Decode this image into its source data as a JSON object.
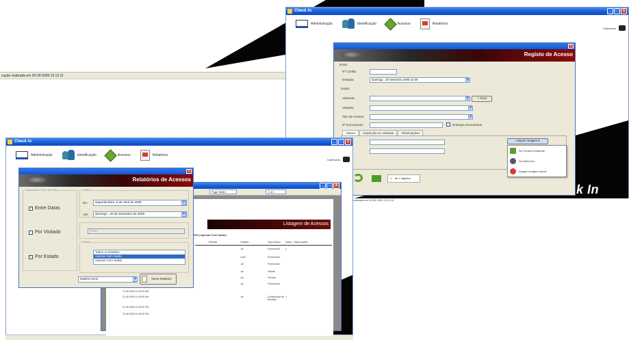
{
  "background_status": {
    "text": "cação realizada em 20-09-2009 22:12:11"
  },
  "top_window": {
    "title": "Check In",
    "nav": {
      "admin": "Administração",
      "ident": "Identificação",
      "acess": "Acessos",
      "rel": "Relatórios"
    },
    "user_label": "Caleridens",
    "status_text": "realizada em 20-09-2009 22:12:11",
    "logo_text": "Check In"
  },
  "registo_dialog": {
    "title": "Registo de Acesso",
    "section_entrada": "Entra",
    "labels": {
      "cartao": "Nº Cartão:",
      "entrada": "Entrada:",
      "saida": "Saída:",
      "visitante": "Visitante:",
      "visitado": "Visitado:",
      "tipo": "Tipo de Acesso:",
      "documento": "Nº Documento:",
      "matricula": "atricula:",
      "viatura": "ra:"
    },
    "values": {
      "cartao": "",
      "entrada": "domingo   , 20 Setembro 2009 22:09",
      "visitante": "",
      "visitado": "",
      "tipo": "",
      "documento": "",
      "matricula": "",
      "viatura": ""
    },
    "novo_button": "Novo",
    "entregou_doc": "Entregou Documento",
    "tabs": [
      "Viatura",
      "Inspecção ao Visitante",
      "Observações"
    ],
    "acquire_button": "Adquirir Imagem",
    "image_menu": [
      "Do Ficheiro Existente",
      "Da WebCam",
      "Apagar Imagem Actual"
    ],
    "record_counter": "1",
    "record_total": "de 1 registos"
  },
  "bottom_window": {
    "title": "Check In",
    "nav": {
      "admin": "Administração",
      "ident": "Identificação",
      "acess": "Acessos",
      "rel": "Relatórios"
    },
    "user_label": "Caleridens"
  },
  "report_window": {
    "page_label": "Page Width",
    "page_nav": "1 of 1",
    "header": "Listagem de Acessos",
    "filter_line": "009 | Apenas Com Saída |",
    "columns": [
      "Entrada",
      "Visitado",
      "Tipo Acesso",
      "Saída",
      "Observações"
    ],
    "rows": [
      {
        "entry": "",
        "visitado": "-se",
        "tipo": "Fornecedor",
        "saida": "1"
      },
      {
        "entry": "",
        "visitado": "Lima",
        "tipo": "Fornecedor",
        "saida": ""
      },
      {
        "entry": "",
        "visitado": "-se",
        "tipo": "Fornecedor",
        "saida": ""
      },
      {
        "entry": "",
        "visitado": "-se",
        "tipo": "Cliente",
        "saida": ""
      },
      {
        "entry": "",
        "visitado": "-se",
        "tipo": "Técnico",
        "saida": ""
      },
      {
        "entry": "",
        "visitado": "-se",
        "tipo": "Fornecedor",
        "saida": ""
      },
      {
        "entry": "21-06-2009 11:00:00 AM",
        "visitado": "",
        "tipo": "",
        "saida": ""
      },
      {
        "entry": "21-06-2009 11:00:00 AM",
        "visitado": "-se",
        "tipo": "Conferencia de Reunião",
        "saida": "1"
      },
      {
        "entry": "21-06-2009 11:00:00 PM",
        "visitado": "",
        "tipo": "",
        "saida": ""
      },
      {
        "entry": "21-06-2009 11:00:00 PM",
        "visitado": "",
        "tipo": "",
        "saida": ""
      }
    ],
    "assigned_name": "escandra A."
  },
  "relatorios_dialog": {
    "title": "Relatórios de Acessos",
    "left_group_label": "Seleccione o Tipo de Filtro",
    "criteria_label": "Critério",
    "filters": [
      {
        "label": "Entre Datas",
        "checked": "✓"
      },
      {
        "label": "Por Visitado",
        "checked": ""
      },
      {
        "label": "Por Estado",
        "checked": "✓"
      }
    ],
    "date_from_label": "De:",
    "date_from": "segunda-feira,  6 de    Abril    de 2009",
    "date_to_label": "Até:",
    "date_to": "domingo   , 20 de Setembro de 2009",
    "visitado_value": "Todos",
    "estado_label": "Estado",
    "estado_options": [
      "Todos os Estados",
      "Apenas Sem Saída",
      "Apenas Com Saída"
    ],
    "estado_selected_index": 1,
    "model_value": "Modelo Geral",
    "generate_button": "Gerar Relatório"
  }
}
